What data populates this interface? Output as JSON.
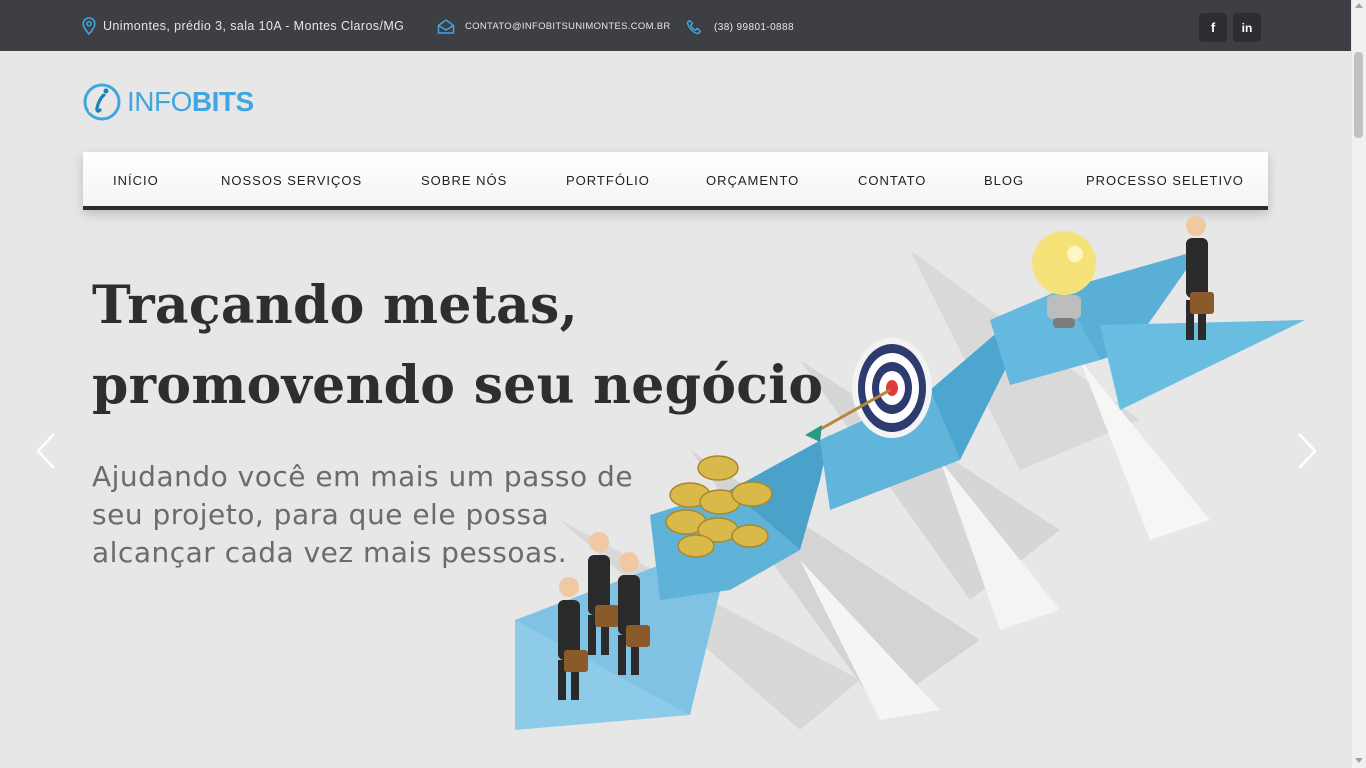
{
  "topbar": {
    "address": "Unimontes, prédio 3, sala 10A - Montes Claros/MG",
    "email": "CONTATO@INFOBITSUNIMONTES.COM.BR",
    "phone": "(38) 99801-0888",
    "social": [
      {
        "label": "f",
        "icon": "facebook-icon"
      },
      {
        "label": "in",
        "icon": "linkedin-icon"
      }
    ]
  },
  "logo": {
    "part1": "INFO",
    "part2": "BITS"
  },
  "nav": {
    "items": [
      {
        "label": "INÍCIO"
      },
      {
        "label": "NOSSOS SERVIÇOS"
      },
      {
        "label": "SOBRE NÓS"
      },
      {
        "label": "PORTFÓLIO"
      },
      {
        "label": "ORÇAMENTO"
      },
      {
        "label": "CONTATO"
      },
      {
        "label": "BLOG"
      },
      {
        "label": "PROCESSO SELETIVO"
      }
    ]
  },
  "hero": {
    "title_line1": "Traçando metas,",
    "title_line2": "promovendo seu negócio",
    "subtitle": "Ajudando você em mais um passo de seu projeto, para que ele possa alcançar cada vez mais pessoas."
  },
  "colors": {
    "topbar_bg": "#3d3f44",
    "accent": "#3fa6df",
    "page_bg": "#e7e7e7"
  }
}
